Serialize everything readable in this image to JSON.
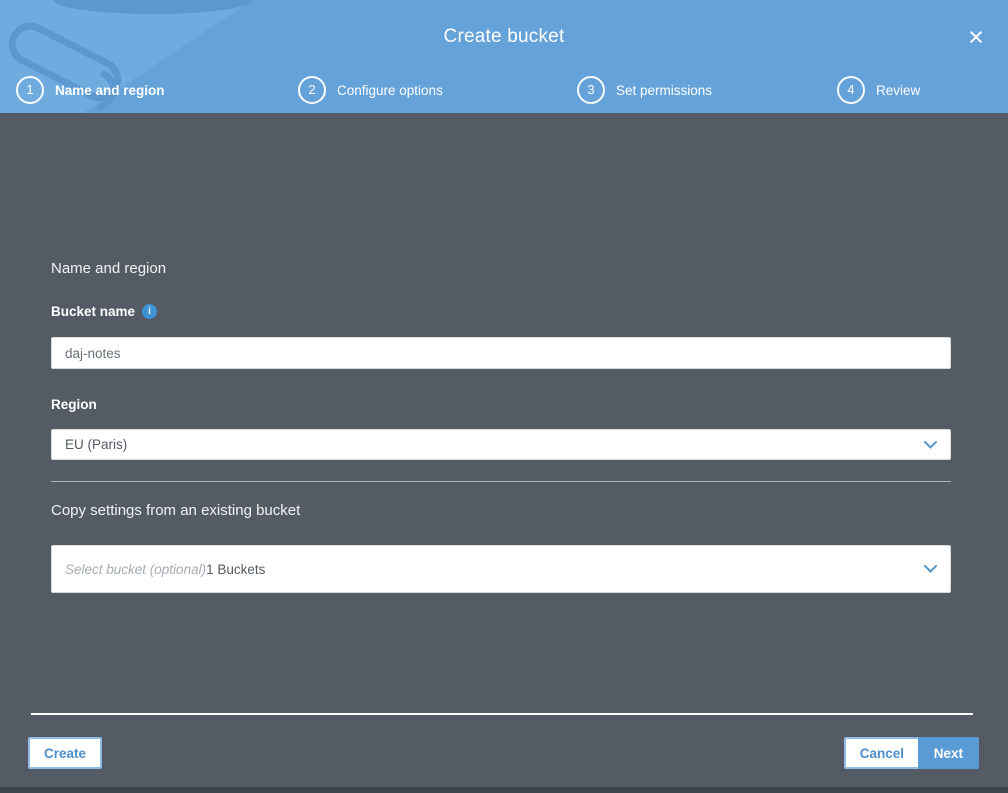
{
  "modal": {
    "title": "Create bucket",
    "close_icon": "×"
  },
  "steps": [
    {
      "number": "1",
      "label": "Name and region",
      "active": true
    },
    {
      "number": "2",
      "label": "Configure options",
      "active": false
    },
    {
      "number": "3",
      "label": "Set permissions",
      "active": false
    },
    {
      "number": "4",
      "label": "Review",
      "active": false
    }
  ],
  "form": {
    "section_heading": "Name and region",
    "bucket_name_label": "Bucket name",
    "info_icon": "i",
    "bucket_name_value": "daj-notes",
    "region_label": "Region",
    "region_value": "EU (Paris)",
    "copy_settings_heading": "Copy settings from an existing bucket",
    "copy_bucket_placeholder": "Select bucket (optional)",
    "copy_bucket_count": "1 Buckets"
  },
  "footer": {
    "create_label": "Create",
    "cancel_label": "Cancel",
    "next_label": "Next"
  },
  "colors": {
    "header_blue": "#64a2d9",
    "body_gray": "#545b64",
    "primary_button_blue": "#5a9bd5",
    "accent_text_blue": "#4c8fcb",
    "chevron_blue": "#5595cf",
    "info_icon_blue": "#3e92d6",
    "watermark_blue": "#6fabde"
  }
}
